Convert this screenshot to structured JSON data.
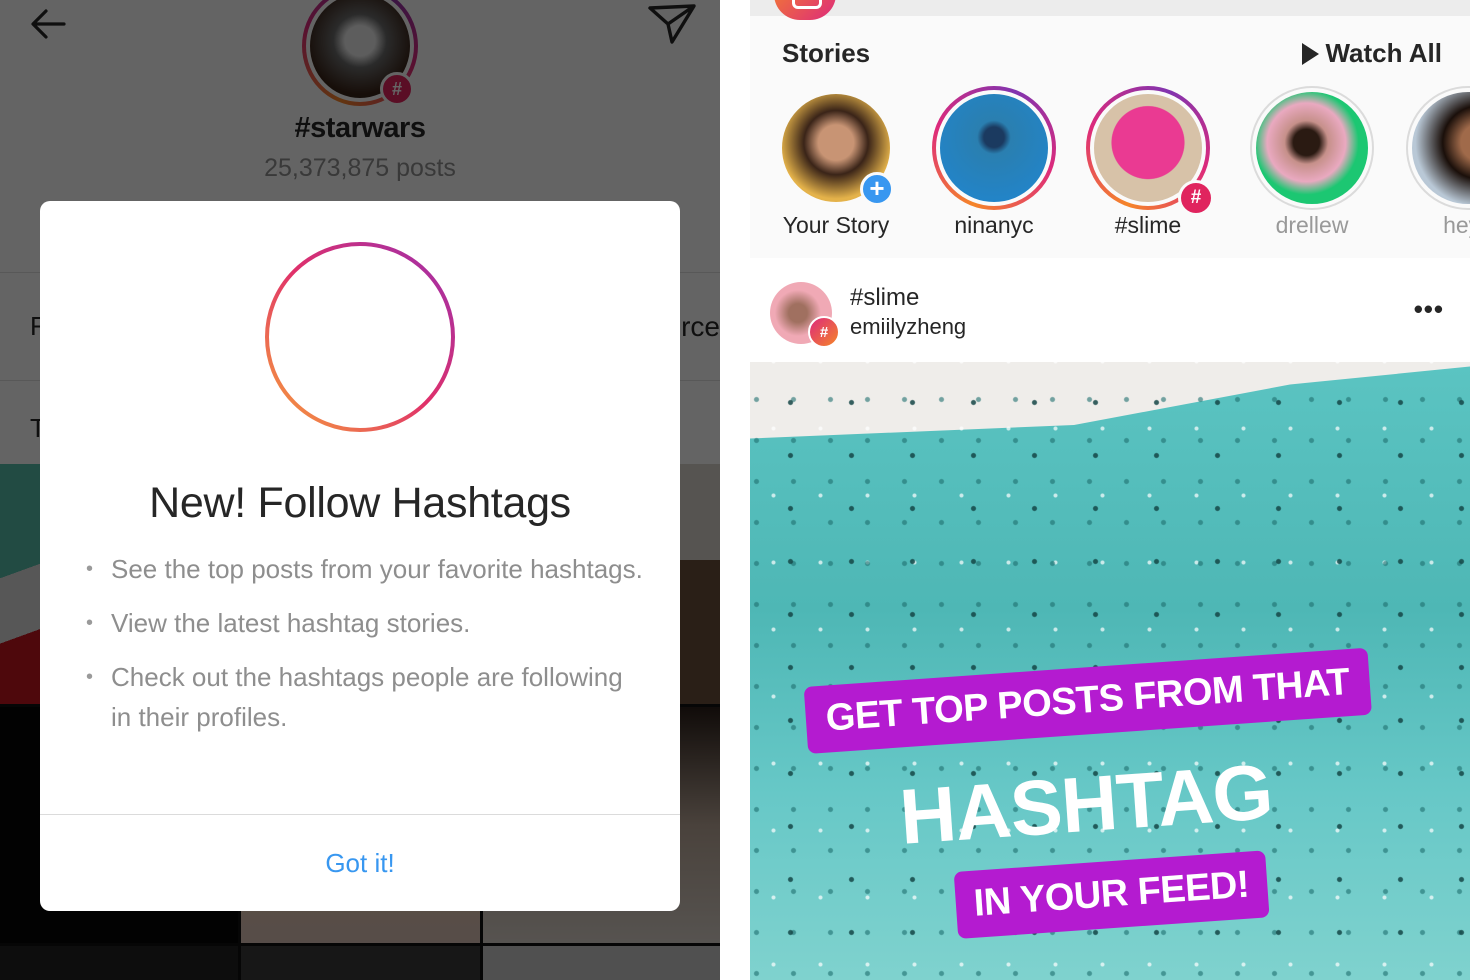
{
  "left_screen": {
    "header": {
      "back_icon": "arrow-left-icon",
      "send_icon": "paper-plane-icon",
      "hashtag_name": "#starwars",
      "post_count": "25,373,875 posts",
      "hashtag_badge": "#"
    },
    "background_rows": {
      "row1_left_partial": "F",
      "row1_right_partial": "orce",
      "row2_left_partial": "T"
    },
    "modal": {
      "icon": "hashtag-circle-icon",
      "title": "New! Follow Hashtags",
      "bullets": [
        "See the top posts from your favorite hashtags.",
        "View the latest hashtag stories.",
        "Check out the hashtags people are following in their profiles."
      ],
      "bullet_glyph": "•",
      "confirm_label": "Got it!"
    }
  },
  "right_screen": {
    "stories": {
      "heading": "Stories",
      "watch_all_label": "Watch All",
      "items": [
        {
          "label": "Your Story",
          "badge": "+",
          "state": "own"
        },
        {
          "label": "ninanyc",
          "state": "unseen"
        },
        {
          "label": "#slime",
          "badge": "#",
          "state": "unseen"
        },
        {
          "label": "drellew",
          "state": "seen"
        },
        {
          "label": "heyb",
          "state": "seen"
        }
      ]
    },
    "post": {
      "title": "#slime",
      "subtitle": "emiilyzheng",
      "avatar_badge": "#",
      "more_label": "•••",
      "image_captions": {
        "line1": "GET TOP POSTS FROM THAT",
        "line2": "HASHTAG",
        "line3": "IN YOUR FEED!"
      }
    }
  },
  "colors": {
    "link_blue": "#3897f0",
    "hashtag_red": "#e0245e",
    "caption_purple": "#b41bd0",
    "gradient_orange": "#f58529",
    "gradient_pink": "#dd2a7b",
    "gradient_purple": "#8134af"
  }
}
